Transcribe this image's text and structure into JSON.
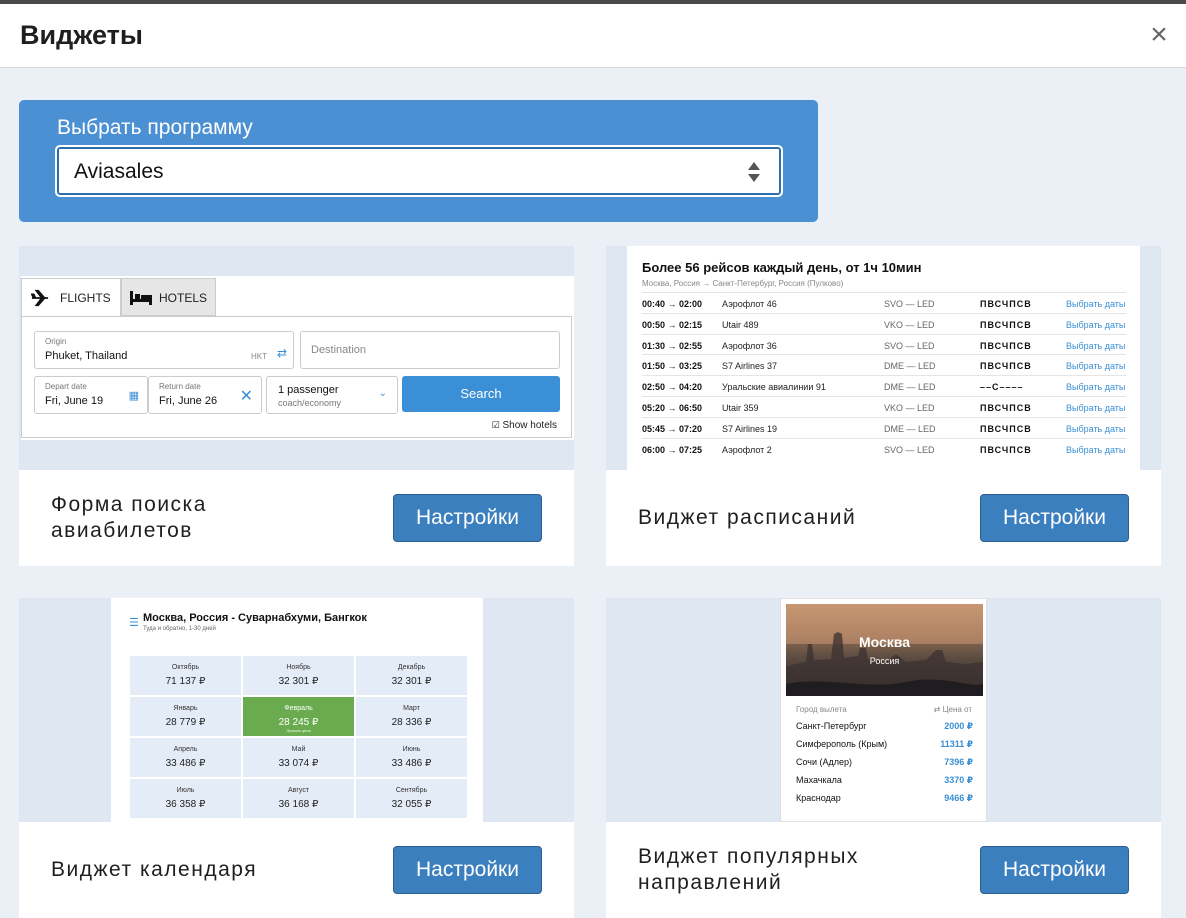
{
  "header": {
    "title": "Виджеты",
    "close": "×"
  },
  "selector": {
    "label": "Выбрать программу",
    "value": "Aviasales"
  },
  "cards": [
    {
      "name_line1": "Форма поиска",
      "name_line2": "авиабилетов",
      "button": "Настройки"
    },
    {
      "name_line1": "Виджет расписаний",
      "button": "Настройки"
    },
    {
      "name_line1": "Виджет календаря",
      "button": "Настройки"
    },
    {
      "name_line1": "Виджет популярных",
      "name_line2": "направлений",
      "button": "Настройки"
    }
  ],
  "flights_form": {
    "tab_flights": "FLIGHTS",
    "tab_hotels": "HOTELS",
    "origin_label": "Origin",
    "origin_value": "Phuket, Thailand",
    "origin_code": "HKT",
    "destination_placeholder": "Destination",
    "depart_label": "Depart date",
    "depart_value": "Fri, June 19",
    "return_label": "Return date",
    "return_value": "Fri, June 26",
    "passengers": "1 passenger",
    "cabin": "coach/economy",
    "search": "Search",
    "show_hotels": "Show hotels"
  },
  "schedule": {
    "title": "Более 56 рейсов каждый день, от 1ч 10мин",
    "route": "Москва, Россия → Санкт-Петербург, Россия (Пулково)",
    "rows": [
      {
        "time": "00:40 → 02:00",
        "airline": "Аэрофлот 46",
        "airports": "SVO — LED",
        "days": "ПВСЧПСВ",
        "link": "Выбрать даты"
      },
      {
        "time": "00:50 → 02:15",
        "airline": "Utair 489",
        "airports": "VKO — LED",
        "days": "ПВСЧПСВ",
        "link": "Выбрать даты"
      },
      {
        "time": "01:30 → 02:55",
        "airline": "Аэрофлот 36",
        "airports": "SVO — LED",
        "days": "ПВСЧПСВ",
        "link": "Выбрать даты"
      },
      {
        "time": "01:50 → 03:25",
        "airline": "S7 Airlines 37",
        "airports": "DME — LED",
        "days": "ПВСЧПСВ",
        "link": "Выбрать даты"
      },
      {
        "time": "02:50 → 04:20",
        "airline": "Уральские авиалинии 91",
        "airports": "DME — LED",
        "days": "––С––––",
        "link": "Выбрать даты"
      },
      {
        "time": "05:20 → 06:50",
        "airline": "Utair 359",
        "airports": "VKO — LED",
        "days": "ПВСЧПСВ",
        "link": "Выбрать даты"
      },
      {
        "time": "05:45 → 07:20",
        "airline": "S7 Airlines 19",
        "airports": "DME — LED",
        "days": "ПВСЧПСВ",
        "link": "Выбрать даты"
      },
      {
        "time": "06:00 → 07:25",
        "airline": "Аэрофлот 2",
        "airports": "SVO — LED",
        "days": "ПВСЧПСВ",
        "link": "Выбрать даты"
      }
    ]
  },
  "calendar": {
    "title": "Москва, Россия - Суварнабхуми, Бангкок",
    "subtitle": "Туда и обратно, 1-30 дней",
    "best_label": "Лучшая цена",
    "cells": [
      {
        "month": "Октябрь",
        "price": "71 137 ₽"
      },
      {
        "month": "Ноябрь",
        "price": "32 301 ₽"
      },
      {
        "month": "Декабрь",
        "price": "32 301 ₽"
      },
      {
        "month": "Январь",
        "price": "28 779 ₽"
      },
      {
        "month": "Февраль",
        "price": "28 245 ₽"
      },
      {
        "month": "Март",
        "price": "28 336 ₽"
      },
      {
        "month": "Апрель",
        "price": "33 486 ₽"
      },
      {
        "month": "Май",
        "price": "33 074 ₽"
      },
      {
        "month": "Июнь",
        "price": "33 486 ₽"
      },
      {
        "month": "Июль",
        "price": "36 358 ₽"
      },
      {
        "month": "Август",
        "price": "36 168 ₽"
      },
      {
        "month": "Сентябрь",
        "price": "32 055 ₽"
      }
    ]
  },
  "popular": {
    "city": "Москва",
    "country": "Россия",
    "col_from": "Город вылета",
    "col_price": "⇄ Цена от",
    "items": [
      {
        "city": "Санкт-Петербург",
        "price": "2000 ₽"
      },
      {
        "city": "Симферополь (Крым)",
        "price": "11311 ₽"
      },
      {
        "city": "Сочи (Адлер)",
        "price": "7396 ₽"
      },
      {
        "city": "Махачкала",
        "price": "3370 ₽"
      },
      {
        "city": "Краснодар",
        "price": "9466 ₽"
      }
    ]
  }
}
